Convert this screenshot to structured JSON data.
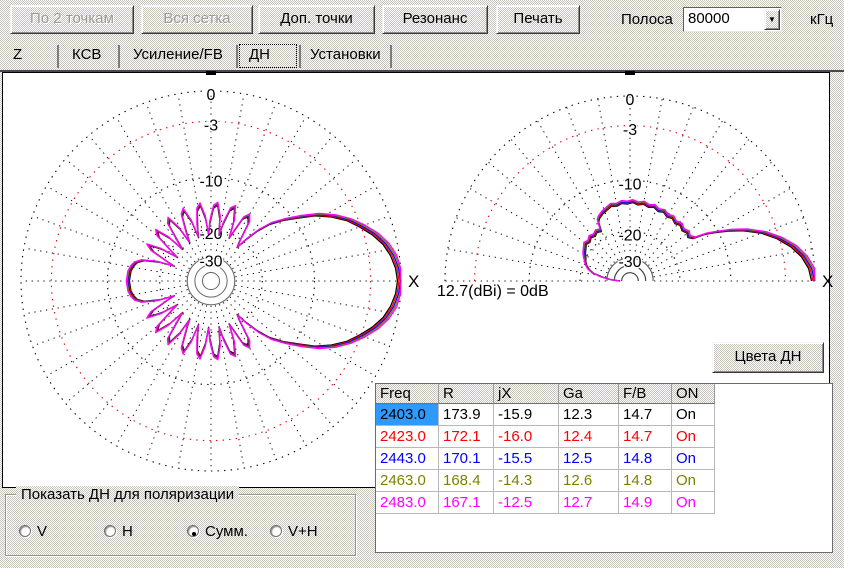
{
  "toolbar": {
    "buttons": [
      {
        "label": "По 2 точкам",
        "enabled": false
      },
      {
        "label": "Вся сетка",
        "enabled": false
      },
      {
        "label": "Доп. точки",
        "enabled": true
      },
      {
        "label": "Резонанс",
        "enabled": true
      },
      {
        "label": "Печать",
        "enabled": true
      }
    ],
    "band": {
      "label": "Полоса",
      "value": "80000",
      "unit": "кГц"
    }
  },
  "tabs": [
    {
      "label": "Z",
      "selected": false
    },
    {
      "label": "КСВ",
      "selected": false
    },
    {
      "label": "Усиление/FB",
      "selected": false
    },
    {
      "label": "ДН",
      "selected": true
    },
    {
      "label": "Установки",
      "selected": false
    }
  ],
  "pattern_view": {
    "ref_label": "12.7(dBi) = 0dB",
    "colors_button_label": "Цвета ДН"
  },
  "chart_data": [
    {
      "type": "polar-line",
      "title": "Azimuth radiation pattern (ДН), dB relative to 12.7 dBi max",
      "full_circle": true,
      "mirror_symmetric": true,
      "x_axis_label": "X",
      "ring_grid": [
        {
          "db": 0,
          "label": "0",
          "color": "#000000",
          "style": "dotted"
        },
        {
          "db": -3,
          "label": "-3",
          "color": "#e00000",
          "style": "dotted"
        },
        {
          "db": -10,
          "label": "-10",
          "color": "#000000",
          "style": "dotted"
        },
        {
          "db": -20,
          "label": "-20",
          "color": "#000000",
          "style": "dotted"
        },
        {
          "db": -30,
          "label": "-30",
          "color": "#666666",
          "style": "solid"
        }
      ],
      "inner_circle_fractions": [
        0.085,
        0.045
      ],
      "db_radius_anchors": [
        [
          0,
          1.0
        ],
        [
          -3,
          0.84
        ],
        [
          -10,
          0.545
        ],
        [
          -20,
          0.27
        ],
        [
          -30,
          0.125
        ],
        [
          -45,
          0.02
        ]
      ],
      "radial_step_deg": 10,
      "series": [
        {
          "name": "2403.0",
          "color": "#000000",
          "db_offset": -0.3
        },
        {
          "name": "2423.0",
          "color": "#ff0000",
          "db_offset": -0.15
        },
        {
          "name": "2443.0",
          "color": "#0000ff",
          "db_offset": 0
        },
        {
          "name": "2463.0",
          "color": "#808000",
          "db_offset": 0.15
        },
        {
          "name": "2483.0",
          "color": "#ff00ff",
          "db_offset": 0.3
        }
      ],
      "points_deg_db": [
        [
          0,
          -0.05
        ],
        [
          4,
          -0.2
        ],
        [
          8,
          -0.55
        ],
        [
          12,
          -1.1
        ],
        [
          16,
          -1.9
        ],
        [
          20,
          -2.9
        ],
        [
          24,
          -4.1
        ],
        [
          28,
          -5.6
        ],
        [
          32,
          -7.3
        ],
        [
          36,
          -9.3
        ],
        [
          40,
          -11.5
        ],
        [
          44,
          -14.0
        ],
        [
          47,
          -16.5
        ],
        [
          50,
          -19.5
        ],
        [
          52,
          -23.0
        ],
        [
          54,
          -21.0
        ],
        [
          57,
          -16.5
        ],
        [
          60,
          -15.3
        ],
        [
          63,
          -16.3
        ],
        [
          65,
          -19.0
        ],
        [
          67,
          -21.5
        ],
        [
          69,
          -17.5
        ],
        [
          72,
          -14.9
        ],
        [
          75,
          -15.6
        ],
        [
          78,
          -18.5
        ],
        [
          80,
          -21.5
        ],
        [
          82,
          -17.5
        ],
        [
          85,
          -15.0
        ],
        [
          88,
          -15.6
        ],
        [
          91,
          -18.5
        ],
        [
          93,
          -21.5
        ],
        [
          95,
          -17.6
        ],
        [
          98,
          -15.0
        ],
        [
          101,
          -15.9
        ],
        [
          104,
          -19.0
        ],
        [
          106,
          -22.0
        ],
        [
          108,
          -17.8
        ],
        [
          111,
          -15.2
        ],
        [
          114,
          -16.1
        ],
        [
          117,
          -19.5
        ],
        [
          119,
          -22.5
        ],
        [
          121,
          -18.0
        ],
        [
          124,
          -15.4
        ],
        [
          127,
          -16.3
        ],
        [
          130,
          -20.0
        ],
        [
          132,
          -23.0
        ],
        [
          134,
          -18.3
        ],
        [
          137,
          -15.6
        ],
        [
          140,
          -16.6
        ],
        [
          143,
          -20.5
        ],
        [
          145,
          -23.5
        ],
        [
          147,
          -18.6
        ],
        [
          150,
          -15.9
        ],
        [
          153,
          -17.2
        ],
        [
          156,
          -21.0
        ],
        [
          158,
          -24.0
        ],
        [
          160,
          -19.0
        ],
        [
          163,
          -16.2
        ],
        [
          166,
          -15.0
        ],
        [
          169,
          -14.5
        ],
        [
          173,
          -14.1
        ],
        [
          180,
          -13.9
        ]
      ]
    },
    {
      "type": "polar-line",
      "title": "Elevation radiation pattern (ДН), dB relative to 12.7 dBi max",
      "full_circle": false,
      "mirror_symmetric": false,
      "x_axis_label": "X",
      "ring_grid": [
        {
          "db": 0,
          "label": "0",
          "color": "#000000",
          "style": "dotted"
        },
        {
          "db": -3,
          "label": "-3",
          "color": "#e00000",
          "style": "dotted"
        },
        {
          "db": -10,
          "label": "-10",
          "color": "#000000",
          "style": "dotted"
        },
        {
          "db": -20,
          "label": "-20",
          "color": "#000000",
          "style": "dotted"
        },
        {
          "db": -30,
          "label": "-30",
          "color": "#555555",
          "style": "solid"
        }
      ],
      "inner_circle_fractions": [
        0.085,
        0.045
      ],
      "db_radius_anchors": [
        [
          0,
          1.0
        ],
        [
          -3,
          0.84
        ],
        [
          -10,
          0.545
        ],
        [
          -20,
          0.27
        ],
        [
          -30,
          0.125
        ],
        [
          -45,
          0.02
        ]
      ],
      "radial_step_deg": 10,
      "series": [
        {
          "name": "2403.0",
          "color": "#000000",
          "db_offset": -0.3
        },
        {
          "name": "2423.0",
          "color": "#ff0000",
          "db_offset": -0.15
        },
        {
          "name": "2443.0",
          "color": "#0000ff",
          "db_offset": 0
        },
        {
          "name": "2463.0",
          "color": "#808000",
          "db_offset": 0.15
        },
        {
          "name": "2483.0",
          "color": "#ff00ff",
          "db_offset": 0.3
        }
      ],
      "points_deg_db": [
        [
          0,
          -0.05
        ],
        [
          4,
          -0.3
        ],
        [
          8,
          -0.9
        ],
        [
          12,
          -1.8
        ],
        [
          16,
          -3.0
        ],
        [
          20,
          -4.7
        ],
        [
          24,
          -6.8
        ],
        [
          27,
          -8.6
        ],
        [
          30,
          -10.6
        ],
        [
          32,
          -12.3
        ],
        [
          34,
          -14.6
        ],
        [
          37,
          -15.3
        ],
        [
          40,
          -14.9
        ],
        [
          44,
          -15.3
        ],
        [
          48,
          -14.8
        ],
        [
          52,
          -15.2
        ],
        [
          56,
          -14.7
        ],
        [
          60,
          -15.0
        ],
        [
          64,
          -14.5
        ],
        [
          68,
          -14.8
        ],
        [
          72,
          -14.3
        ],
        [
          76,
          -14.6
        ],
        [
          80,
          -14.2
        ],
        [
          84,
          -14.5
        ],
        [
          88,
          -14.1
        ],
        [
          92,
          -14.4
        ],
        [
          96,
          -14.2
        ],
        [
          100,
          -14.6
        ],
        [
          104,
          -14.4
        ],
        [
          108,
          -14.9
        ],
        [
          112,
          -15.3
        ],
        [
          116,
          -15.9
        ],
        [
          118,
          -16.4
        ],
        [
          120,
          -18.3
        ],
        [
          124,
          -18.0
        ],
        [
          128,
          -18.4
        ],
        [
          132,
          -18.1
        ],
        [
          136,
          -18.6
        ],
        [
          140,
          -18.3
        ],
        [
          144,
          -18.8
        ],
        [
          148,
          -19.2
        ],
        [
          152,
          -19.7
        ],
        [
          156,
          -20.3
        ],
        [
          160,
          -21.2
        ],
        [
          164,
          -22.5
        ],
        [
          168,
          -24.5
        ],
        [
          172,
          -28.0
        ],
        [
          176,
          -33.0
        ],
        [
          180,
          -40.0
        ]
      ]
    }
  ],
  "table": {
    "headers": [
      "Freq",
      "R",
      "jX",
      "Ga",
      "F/B",
      "ON"
    ],
    "rows": [
      {
        "cells": [
          "2403.0",
          "173.9",
          "-15.9",
          "12.3",
          "14.7",
          "On"
        ],
        "color": "#000000"
      },
      {
        "cells": [
          "2423.0",
          "172.1",
          "-16.0",
          "12.4",
          "14.7",
          "On"
        ],
        "color": "#ff0000"
      },
      {
        "cells": [
          "2443.0",
          "170.1",
          "-15.5",
          "12.5",
          "14.8",
          "On"
        ],
        "color": "#0000ff"
      },
      {
        "cells": [
          "2463.0",
          "168.4",
          "-14.3",
          "12.6",
          "14.8",
          "On"
        ],
        "color": "#808000"
      },
      {
        "cells": [
          "2483.0",
          "167.1",
          "-12.5",
          "12.7",
          "14.9",
          "On"
        ],
        "color": "#ff00ff"
      }
    ],
    "selected_cell": {
      "row": 0,
      "col": 0,
      "bg": "#2e9aff"
    }
  },
  "polarization": {
    "title": "Показать ДН для поляризации",
    "options": [
      {
        "label": "V",
        "selected": false
      },
      {
        "label": "H",
        "selected": false
      },
      {
        "label": "Сумм.",
        "selected": true
      },
      {
        "label": "V+H",
        "selected": false
      }
    ]
  }
}
